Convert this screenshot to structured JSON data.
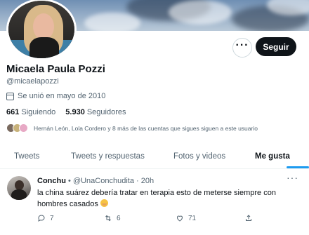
{
  "profile": {
    "name": "Micaela Paula Pozzi",
    "handle": "@micaelapozzi",
    "joined": "Se unió en mayo de 2010",
    "following_count": "661",
    "following_label": "Siguiendo",
    "followers_count": "5.930",
    "followers_label": "Seguidores",
    "mutuals_text": "Hernán León, Lola Cordero y 8 más de las cuentas que sigues siguen a este usuario",
    "follow_button": "Seguir",
    "more_button": "···"
  },
  "tabs": [
    {
      "label": "Tweets",
      "active": false
    },
    {
      "label": "Tweets y respuestas",
      "active": false
    },
    {
      "label": "Fotos y videos",
      "active": false
    },
    {
      "label": "Me gusta",
      "active": true
    }
  ],
  "tweet": {
    "author": "Conchu",
    "separator": "•",
    "handle": "@UnaConchudita",
    "dot": "·",
    "time": "20h",
    "more": "···",
    "text": "la china suárez debería tratar en terapia esto de meterse siempre con hombres casados",
    "emoji": "smiling-face-emoji",
    "replies": "7",
    "retweets": "6",
    "likes": "71"
  },
  "colors": {
    "accent": "#1d9bf0",
    "text_primary": "#0f1419",
    "text_secondary": "#536471",
    "follow_button_bg": "#0f1419"
  }
}
